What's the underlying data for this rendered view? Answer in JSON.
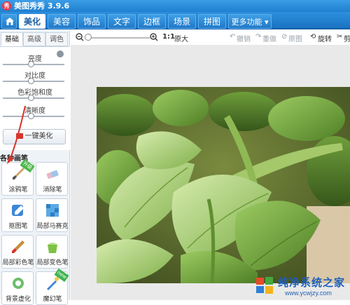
{
  "window": {
    "title": "美图秀秀 3.9.6",
    "logo_text": "秀"
  },
  "tabs": [
    {
      "label": "美化",
      "active": true
    },
    {
      "label": "美容"
    },
    {
      "label": "饰品"
    },
    {
      "label": "文字"
    },
    {
      "label": "边框"
    },
    {
      "label": "场景"
    },
    {
      "label": "拼图"
    },
    {
      "label": "更多功能 ▾"
    }
  ],
  "toolbar": {
    "zoom_ratio": "1:1",
    "original_size": "原大",
    "undo": "撤销",
    "redo": "重做",
    "original_image": "原图",
    "rotate": "旋转",
    "crop": "剪"
  },
  "left_panel": {
    "subtabs": [
      "基础",
      "高级",
      "调色"
    ],
    "adjustments": [
      {
        "label": "亮度",
        "value": 0.0
      },
      {
        "label": "对比度",
        "value": 0.0
      },
      {
        "label": "色彩饱和度",
        "value": 0.0
      },
      {
        "label": "清晰度",
        "value": 0.0
      }
    ],
    "one_key_label": "一键美化",
    "section_title": "各种画笔",
    "tools": [
      {
        "label": "涂鸦笔",
        "badge": "升级"
      },
      {
        "label": "消除笔"
      },
      {
        "label": "抠图笔"
      },
      {
        "label": "局部马赛克"
      },
      {
        "label": "局部彩色笔"
      },
      {
        "label": "局部变色笔"
      },
      {
        "label": "背景虚化"
      },
      {
        "label": "魔幻笔",
        "badge": "new"
      }
    ]
  },
  "watermark": {
    "title": "纯净系统之家",
    "url": "www.ycwjzy.com"
  },
  "colors": {
    "accent": "#1f80d0",
    "arrow": "#d9342b",
    "badge_green": "#4cb848"
  }
}
